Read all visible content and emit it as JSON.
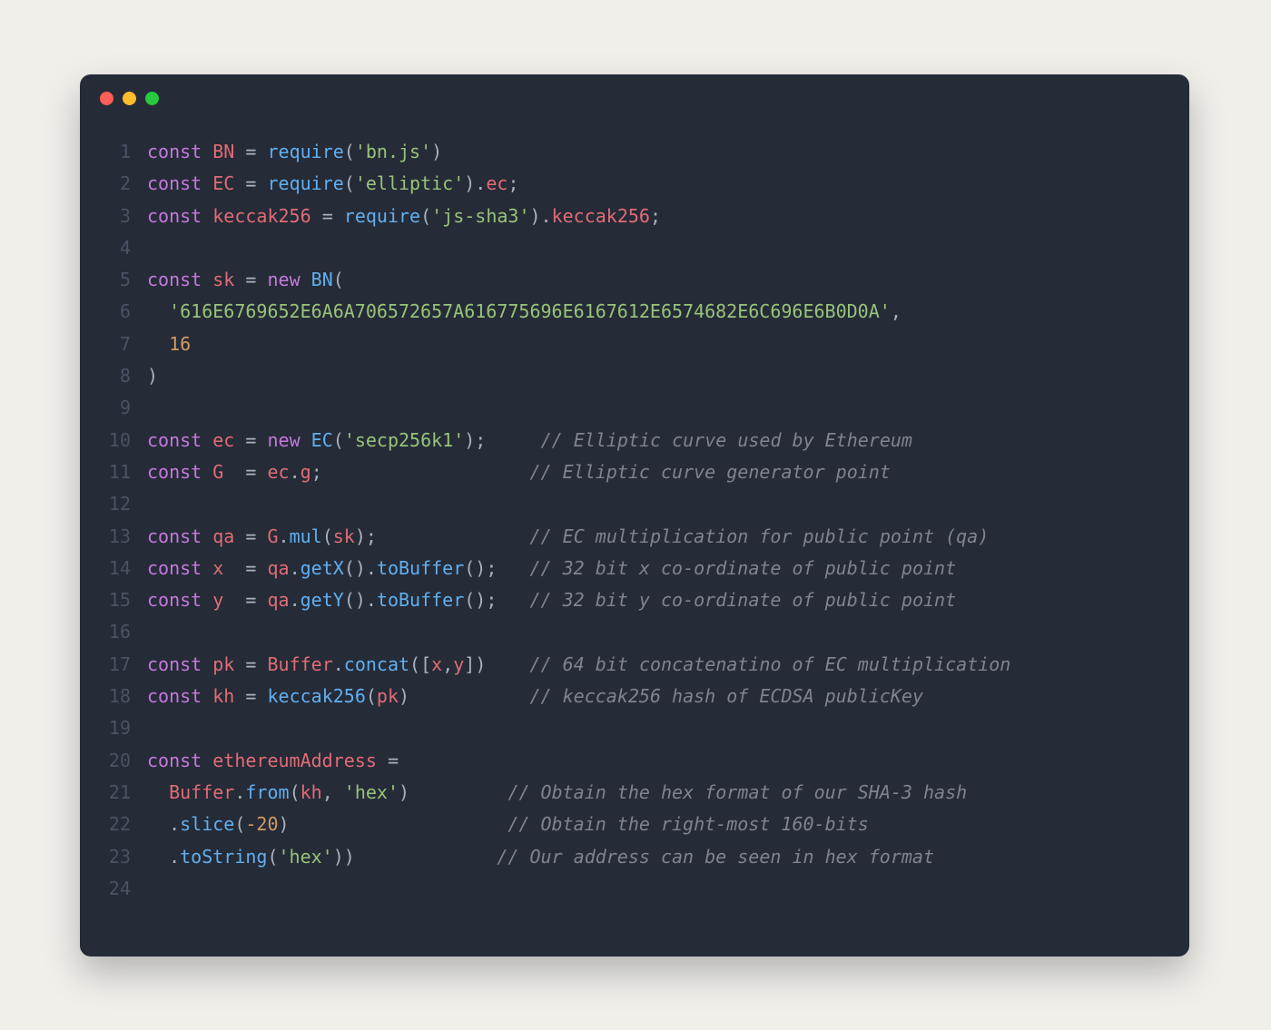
{
  "colors": {
    "page_bg": "#f0efea",
    "editor_bg": "#252b37",
    "gutter": "#4a5364",
    "keyword": "#c678dd",
    "variable": "#e06c75",
    "function": "#61afef",
    "string": "#98c379",
    "number": "#d19a66",
    "punctuation": "#abb2bf",
    "comment": "#7f848e",
    "traffic_red": "#ff5f56",
    "traffic_yellow": "#ffbd2e",
    "traffic_green": "#27c93f"
  },
  "titlebar": {
    "dots": [
      "red",
      "yellow",
      "green"
    ]
  },
  "code": {
    "lines": [
      {
        "n": "1",
        "tokens": [
          [
            "kw",
            "const"
          ],
          [
            "pn",
            " "
          ],
          [
            "vn",
            "BN"
          ],
          [
            "pn",
            " "
          ],
          [
            "pn",
            "="
          ],
          [
            "pn",
            " "
          ],
          [
            "fn",
            "require"
          ],
          [
            "pn",
            "("
          ],
          [
            "str",
            "'bn.js'"
          ],
          [
            "pn",
            ")"
          ]
        ]
      },
      {
        "n": "2",
        "tokens": [
          [
            "kw",
            "const"
          ],
          [
            "pn",
            " "
          ],
          [
            "vn",
            "EC"
          ],
          [
            "pn",
            " "
          ],
          [
            "pn",
            "="
          ],
          [
            "pn",
            " "
          ],
          [
            "fn",
            "require"
          ],
          [
            "pn",
            "("
          ],
          [
            "str",
            "'elliptic'"
          ],
          [
            "pn",
            ")."
          ],
          [
            "vn",
            "ec"
          ],
          [
            "pn",
            ";"
          ]
        ]
      },
      {
        "n": "3",
        "tokens": [
          [
            "kw",
            "const"
          ],
          [
            "pn",
            " "
          ],
          [
            "vn",
            "keccak256"
          ],
          [
            "pn",
            " "
          ],
          [
            "pn",
            "="
          ],
          [
            "pn",
            " "
          ],
          [
            "fn",
            "require"
          ],
          [
            "pn",
            "("
          ],
          [
            "str",
            "'js-sha3'"
          ],
          [
            "pn",
            ")."
          ],
          [
            "vn",
            "keccak256"
          ],
          [
            "pn",
            ";"
          ]
        ]
      },
      {
        "n": "4",
        "tokens": []
      },
      {
        "n": "5",
        "tokens": [
          [
            "kw",
            "const"
          ],
          [
            "pn",
            " "
          ],
          [
            "vn",
            "sk"
          ],
          [
            "pn",
            " "
          ],
          [
            "pn",
            "="
          ],
          [
            "pn",
            " "
          ],
          [
            "kw",
            "new"
          ],
          [
            "pn",
            " "
          ],
          [
            "fn",
            "BN"
          ],
          [
            "pn",
            "("
          ]
        ]
      },
      {
        "n": "6",
        "tokens": [
          [
            "pn",
            "  "
          ],
          [
            "str",
            "'616E6769652E6A6A706572657A616775696E6167612E6574682E6C696E6B0D0A'"
          ],
          [
            "pn",
            ","
          ]
        ]
      },
      {
        "n": "7",
        "tokens": [
          [
            "pn",
            "  "
          ],
          [
            "num",
            "16"
          ]
        ]
      },
      {
        "n": "8",
        "tokens": [
          [
            "pn",
            ")"
          ]
        ]
      },
      {
        "n": "9",
        "tokens": []
      },
      {
        "n": "10",
        "tokens": [
          [
            "kw",
            "const"
          ],
          [
            "pn",
            " "
          ],
          [
            "vn",
            "ec"
          ],
          [
            "pn",
            " "
          ],
          [
            "pn",
            "="
          ],
          [
            "pn",
            " "
          ],
          [
            "kw",
            "new"
          ],
          [
            "pn",
            " "
          ],
          [
            "fn",
            "EC"
          ],
          [
            "pn",
            "("
          ],
          [
            "str",
            "'secp256k1'"
          ],
          [
            "pn",
            ");"
          ],
          [
            "pn",
            "     "
          ],
          [
            "cm",
            "// Elliptic curve used by Ethereum"
          ]
        ]
      },
      {
        "n": "11",
        "tokens": [
          [
            "kw",
            "const"
          ],
          [
            "pn",
            " "
          ],
          [
            "vn",
            "G"
          ],
          [
            "pn",
            "  "
          ],
          [
            "pn",
            "="
          ],
          [
            "pn",
            " "
          ],
          [
            "vn",
            "ec"
          ],
          [
            "pn",
            "."
          ],
          [
            "vn",
            "g"
          ],
          [
            "pn",
            ";"
          ],
          [
            "pn",
            "                   "
          ],
          [
            "cm",
            "// Elliptic curve generator point"
          ]
        ]
      },
      {
        "n": "12",
        "tokens": []
      },
      {
        "n": "13",
        "tokens": [
          [
            "kw",
            "const"
          ],
          [
            "pn",
            " "
          ],
          [
            "vn",
            "qa"
          ],
          [
            "pn",
            " "
          ],
          [
            "pn",
            "="
          ],
          [
            "pn",
            " "
          ],
          [
            "vn",
            "G"
          ],
          [
            "pn",
            "."
          ],
          [
            "fn",
            "mul"
          ],
          [
            "pn",
            "("
          ],
          [
            "vn",
            "sk"
          ],
          [
            "pn",
            ");"
          ],
          [
            "pn",
            "              "
          ],
          [
            "cm",
            "// EC multiplication for public point (qa)"
          ]
        ]
      },
      {
        "n": "14",
        "tokens": [
          [
            "kw",
            "const"
          ],
          [
            "pn",
            " "
          ],
          [
            "vn",
            "x"
          ],
          [
            "pn",
            "  "
          ],
          [
            "pn",
            "="
          ],
          [
            "pn",
            " "
          ],
          [
            "vn",
            "qa"
          ],
          [
            "pn",
            "."
          ],
          [
            "fn",
            "getX"
          ],
          [
            "pn",
            "()."
          ],
          [
            "fn",
            "toBuffer"
          ],
          [
            "pn",
            "();"
          ],
          [
            "pn",
            "   "
          ],
          [
            "cm",
            "// 32 bit x co-ordinate of public point"
          ]
        ]
      },
      {
        "n": "15",
        "tokens": [
          [
            "kw",
            "const"
          ],
          [
            "pn",
            " "
          ],
          [
            "vn",
            "y"
          ],
          [
            "pn",
            "  "
          ],
          [
            "pn",
            "="
          ],
          [
            "pn",
            " "
          ],
          [
            "vn",
            "qa"
          ],
          [
            "pn",
            "."
          ],
          [
            "fn",
            "getY"
          ],
          [
            "pn",
            "()."
          ],
          [
            "fn",
            "toBuffer"
          ],
          [
            "pn",
            "();"
          ],
          [
            "pn",
            "   "
          ],
          [
            "cm",
            "// 32 bit y co-ordinate of public point"
          ]
        ]
      },
      {
        "n": "16",
        "tokens": []
      },
      {
        "n": "17",
        "tokens": [
          [
            "kw",
            "const"
          ],
          [
            "pn",
            " "
          ],
          [
            "vn",
            "pk"
          ],
          [
            "pn",
            " "
          ],
          [
            "pn",
            "="
          ],
          [
            "pn",
            " "
          ],
          [
            "vn",
            "Buffer"
          ],
          [
            "pn",
            "."
          ],
          [
            "fn",
            "concat"
          ],
          [
            "pn",
            "(["
          ],
          [
            "vn",
            "x"
          ],
          [
            "pn",
            ","
          ],
          [
            "vn",
            "y"
          ],
          [
            "pn",
            "])"
          ],
          [
            "pn",
            "    "
          ],
          [
            "cm",
            "// 64 bit concatenatino of EC multiplication"
          ]
        ]
      },
      {
        "n": "18",
        "tokens": [
          [
            "kw",
            "const"
          ],
          [
            "pn",
            " "
          ],
          [
            "vn",
            "kh"
          ],
          [
            "pn",
            " "
          ],
          [
            "pn",
            "="
          ],
          [
            "pn",
            " "
          ],
          [
            "fn",
            "keccak256"
          ],
          [
            "pn",
            "("
          ],
          [
            "vn",
            "pk"
          ],
          [
            "pn",
            ")"
          ],
          [
            "pn",
            "           "
          ],
          [
            "cm",
            "// keccak256 hash of ECDSA publicKey"
          ]
        ]
      },
      {
        "n": "19",
        "tokens": []
      },
      {
        "n": "20",
        "tokens": [
          [
            "kw",
            "const"
          ],
          [
            "pn",
            " "
          ],
          [
            "vn",
            "ethereumAddress"
          ],
          [
            "pn",
            " "
          ],
          [
            "pn",
            "="
          ]
        ]
      },
      {
        "n": "21",
        "tokens": [
          [
            "pn",
            "  "
          ],
          [
            "vn",
            "Buffer"
          ],
          [
            "pn",
            "."
          ],
          [
            "fn",
            "from"
          ],
          [
            "pn",
            "("
          ],
          [
            "vn",
            "kh"
          ],
          [
            "pn",
            ", "
          ],
          [
            "str",
            "'hex'"
          ],
          [
            "pn",
            ")"
          ],
          [
            "pn",
            "         "
          ],
          [
            "cm",
            "// Obtain the hex format of our SHA-3 hash"
          ]
        ]
      },
      {
        "n": "22",
        "tokens": [
          [
            "pn",
            "  ."
          ],
          [
            "fn",
            "slice"
          ],
          [
            "pn",
            "("
          ],
          [
            "num",
            "-20"
          ],
          [
            "pn",
            ")"
          ],
          [
            "pn",
            "                    "
          ],
          [
            "cm",
            "// Obtain the right-most 160-bits"
          ]
        ]
      },
      {
        "n": "23",
        "tokens": [
          [
            "pn",
            "  ."
          ],
          [
            "fn",
            "toString"
          ],
          [
            "pn",
            "("
          ],
          [
            "str",
            "'hex'"
          ],
          [
            "pn",
            "))"
          ],
          [
            "pn",
            "             "
          ],
          [
            "cm",
            "// Our address can be seen in hex format"
          ]
        ]
      },
      {
        "n": "24",
        "tokens": []
      }
    ]
  }
}
